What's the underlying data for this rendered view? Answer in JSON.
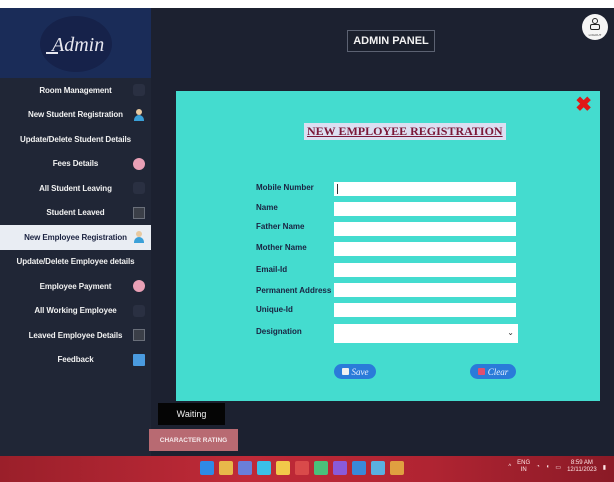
{
  "logo": {
    "text": "Admin"
  },
  "header": {
    "title": "ADMIN PANEL",
    "logout_label": "LOGOUT"
  },
  "sidebar": {
    "items": [
      {
        "label": "Room Management",
        "icon": "room-icon",
        "active": false
      },
      {
        "label": "New Student Registration",
        "icon": "student-user-icon",
        "active": false
      },
      {
        "label": "Update/Delete Student Details",
        "icon": "",
        "active": false
      },
      {
        "label": "Fees Details",
        "icon": "money-icon",
        "active": false
      },
      {
        "label": "All Student Leaving",
        "icon": "list-icon",
        "active": false
      },
      {
        "label": "Student Leaved",
        "icon": "box-icon",
        "active": false
      },
      {
        "label": "New Employee Registration",
        "icon": "employee-user-icon",
        "active": true
      },
      {
        "label": "Update/Delete Employee details",
        "icon": "",
        "active": false
      },
      {
        "label": "Employee Payment",
        "icon": "money-icon",
        "active": false
      },
      {
        "label": "All Working Employee",
        "icon": "list-icon",
        "active": false
      },
      {
        "label": "Leaved Employee Details",
        "icon": "box-icon",
        "active": false
      },
      {
        "label": "Feedback",
        "icon": "feedback-icon",
        "active": false
      }
    ]
  },
  "form": {
    "title": "NEW EMPLOYEE REGISTRATION",
    "fields": [
      {
        "label": "Mobile Number",
        "value": ""
      },
      {
        "label": "Name",
        "value": ""
      },
      {
        "label": "Father Name",
        "value": ""
      },
      {
        "label": "Mother Name",
        "value": ""
      },
      {
        "label": "Email-Id",
        "value": ""
      },
      {
        "label": "Permanent Address",
        "value": ""
      },
      {
        "label": "Unique-Id",
        "value": ""
      }
    ],
    "designation": {
      "label": "Designation",
      "value": ""
    },
    "save_label": "Save",
    "clear_label": "Clear"
  },
  "status": {
    "waiting": "Waiting",
    "character_rating": "CHARACTER RATING"
  },
  "taskbar": {
    "lang_top": "ENG",
    "lang_bottom": "IN",
    "time": "8:59 AM",
    "date": "12/11/2023"
  },
  "colors": {
    "panel": "#44dccf",
    "sidebar": "#202636",
    "close": "#e01818",
    "title": "#7a1838",
    "button": "#2a7bd9"
  }
}
